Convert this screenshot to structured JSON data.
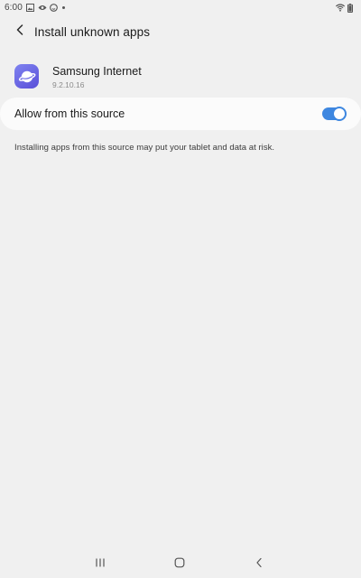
{
  "status_bar": {
    "time": "6:00",
    "left_icons": [
      "image-icon",
      "eye-icon",
      "face-icon",
      "notification-dot"
    ],
    "right_icons": [
      "wifi-icon",
      "battery-icon"
    ]
  },
  "header": {
    "title": "Install unknown apps",
    "back_icon": "back-arrow-icon"
  },
  "app": {
    "name": "Samsung Internet",
    "version": "9.2.10.16",
    "icon": "samsung-internet-icon"
  },
  "setting": {
    "label": "Allow from this source",
    "enabled": true,
    "accent": "#3e87e0"
  },
  "warning": {
    "text": "Installing apps from this source may put your tablet and data at risk."
  },
  "nav_bar": {
    "buttons": [
      "recents-icon",
      "home-icon",
      "back-icon"
    ]
  },
  "colors": {
    "background": "#f0f0f0",
    "card": "#fbfbfb",
    "app_icon": "#6b68e6"
  }
}
